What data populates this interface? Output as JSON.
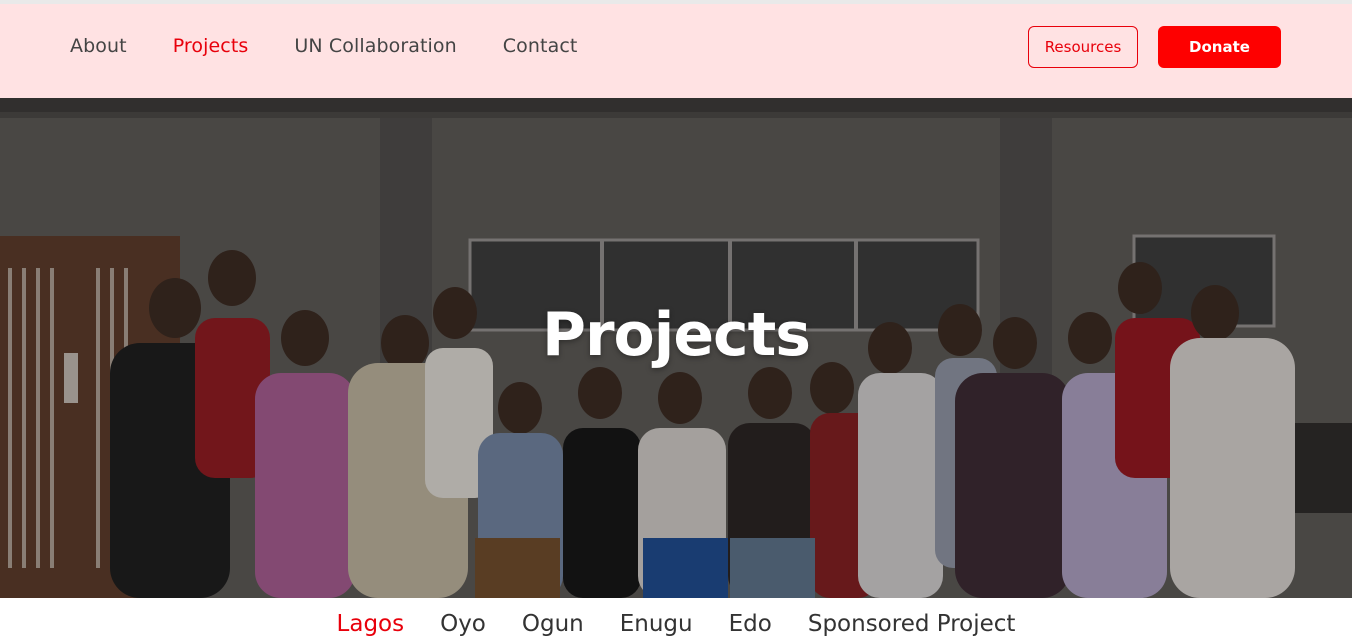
{
  "nav": {
    "links": [
      {
        "label": "About",
        "active": false
      },
      {
        "label": "Projects",
        "active": true
      },
      {
        "label": "UN Collaboration",
        "active": false
      },
      {
        "label": "Contact",
        "active": false
      }
    ],
    "resources_label": "Resources",
    "donate_label": "Donate"
  },
  "hero": {
    "title": "Projects",
    "image_description_icon": "group-photo-image"
  },
  "subnav": {
    "items": [
      {
        "label": "Lagos",
        "active": true
      },
      {
        "label": "Oyo",
        "active": false
      },
      {
        "label": "Ogun",
        "active": false
      },
      {
        "label": "Enugu",
        "active": false
      },
      {
        "label": "Edo",
        "active": false
      },
      {
        "label": "Sponsored Project",
        "active": false
      }
    ]
  },
  "colors": {
    "accent": "#e8000b",
    "donate_bg": "#fe0000",
    "navbar_bg": "#ffe2e3",
    "text": "#444444"
  }
}
